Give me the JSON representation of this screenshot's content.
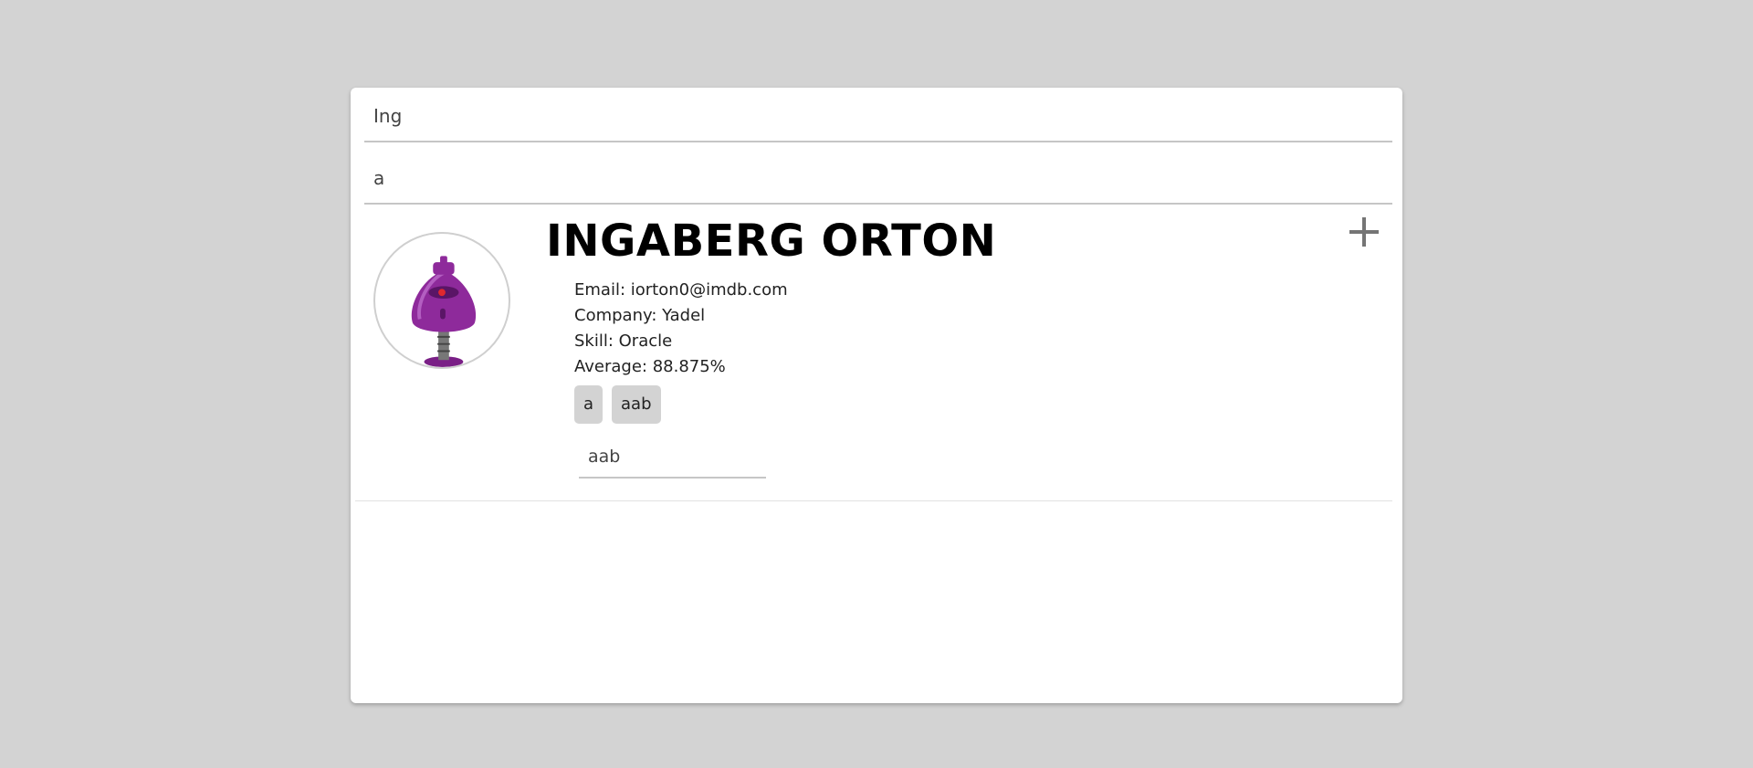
{
  "search": {
    "name_value": "Ing",
    "tag_value": "a"
  },
  "student": {
    "name": "INGABERG ORTON",
    "email": "Email: iorton0@imdb.com",
    "company": "Company: Yadel",
    "skill": "Skill: Oracle",
    "average": "Average: 88.875%",
    "tags": [
      "a",
      "aab"
    ],
    "add_tag_value": "aab",
    "expand_icon": "plus-icon"
  },
  "colors": {
    "background": "#d3d3d3",
    "card": "#ffffff",
    "tag_background": "#d3d3d3",
    "avatar_primary": "#8e2a9b"
  }
}
